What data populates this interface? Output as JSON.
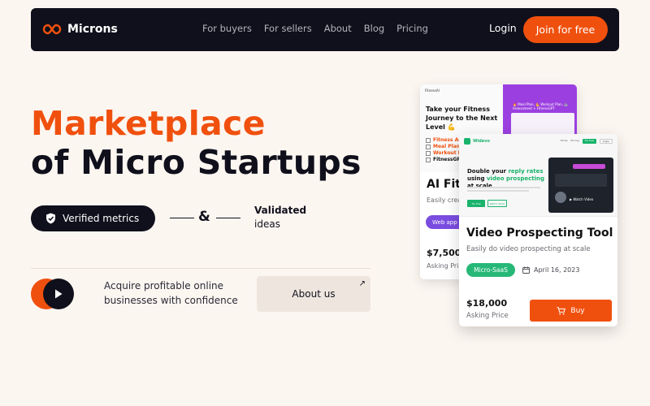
{
  "nav": {
    "brand": "Microns",
    "links": [
      "For buyers",
      "For sellers",
      "About",
      "Blog",
      "Pricing"
    ],
    "login": "Login",
    "join": "Join for free"
  },
  "hero": {
    "title_line1": "Marketplace",
    "title_line2": "of Micro Startups",
    "verified": "Verified metrics",
    "amp": "&",
    "validated_bold": "Validated",
    "validated_rest": "ideas",
    "acquire": "Acquire profitable online businesses with confidence",
    "about": "About us"
  },
  "card_back": {
    "brand": "FitnessAI",
    "shot_title": "Take your Fitness Journey to the Next Level 💪",
    "shot_list": [
      "Fitness Asses",
      "Meal Plan",
      "Workout Plan",
      "FitnessGPT"
    ],
    "shot_banner": "🔥 Meal Plan, 💪 Workout Plan, 🦾 Assessment + FitnessGPT",
    "name": "AI Fitr",
    "subtitle": "Easily creat",
    "tag": "Web app",
    "price": "$7,500",
    "asking": "Asking Price"
  },
  "card_front": {
    "brand": "Widevo",
    "menu": [
      "Home",
      "Pricing",
      "Try free",
      "Login"
    ],
    "hero_a": "Double your ",
    "hero_g1": "reply rates",
    "hero_b": " using ",
    "hero_g2": "video prospecting",
    "hero_c": " at scale",
    "btn1": "Try free",
    "btn2": "Watch demo",
    "video_caption": "▶ Watch Video",
    "name": "Video Prospecting Tool",
    "subtitle": "Easily do video prospecting at scale",
    "tag": "Micro-SaaS",
    "date": "April 16, 2023",
    "price": "$18,000",
    "asking": "Asking Price",
    "buy": "Buy"
  },
  "colors": {
    "accent": "#f0500e",
    "dark": "#10101c",
    "background": "#fcf6f1",
    "green": "#27b878",
    "purple": "#7a4ce0"
  }
}
